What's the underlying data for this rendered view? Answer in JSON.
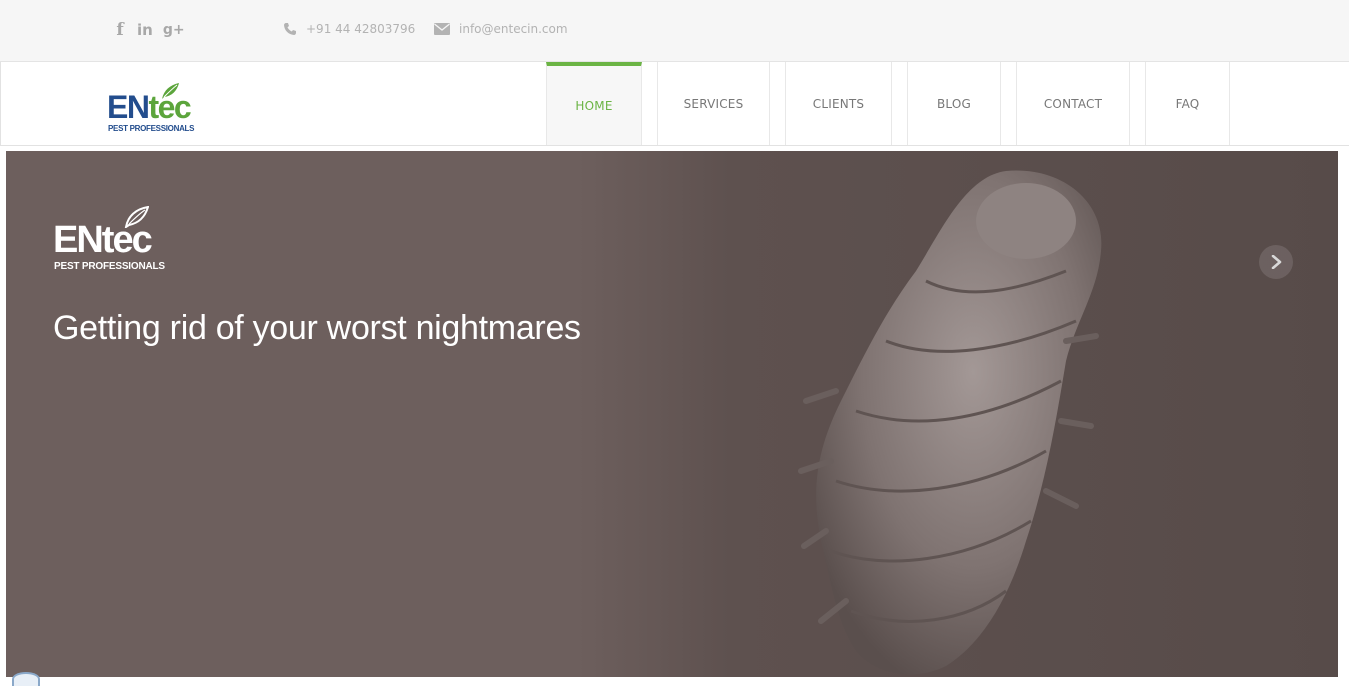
{
  "topbar": {
    "social": [
      {
        "name": "facebook-icon",
        "glyph": "f"
      },
      {
        "name": "linkedin-icon",
        "glyph": "in"
      },
      {
        "name": "google-plus-icon",
        "glyph": "g+"
      }
    ],
    "phone": "+91 44 42803796",
    "email": "info@entecin.com"
  },
  "brand": {
    "name_part1": "EN",
    "name_part2": "tec",
    "tagline": "PEST PROFESSIONALS",
    "colors": {
      "blue": "#234d8d",
      "green": "#5ca53c"
    }
  },
  "nav": {
    "items": [
      {
        "label": "HOME",
        "active": true
      },
      {
        "label": "SERVICES",
        "active": false
      },
      {
        "label": "CLIENTS",
        "active": false
      },
      {
        "label": "BLOG",
        "active": false
      },
      {
        "label": "CONTACT",
        "active": false
      },
      {
        "label": "FAQ",
        "active": false
      }
    ],
    "accent": "#6bb444"
  },
  "hero": {
    "logo_part1": "EN",
    "logo_part2": "tec",
    "logo_tagline": "PEST PROFESSIONALS",
    "headline": "Getting rid of your worst nightmares",
    "next_icon": "chevron-right-icon"
  }
}
